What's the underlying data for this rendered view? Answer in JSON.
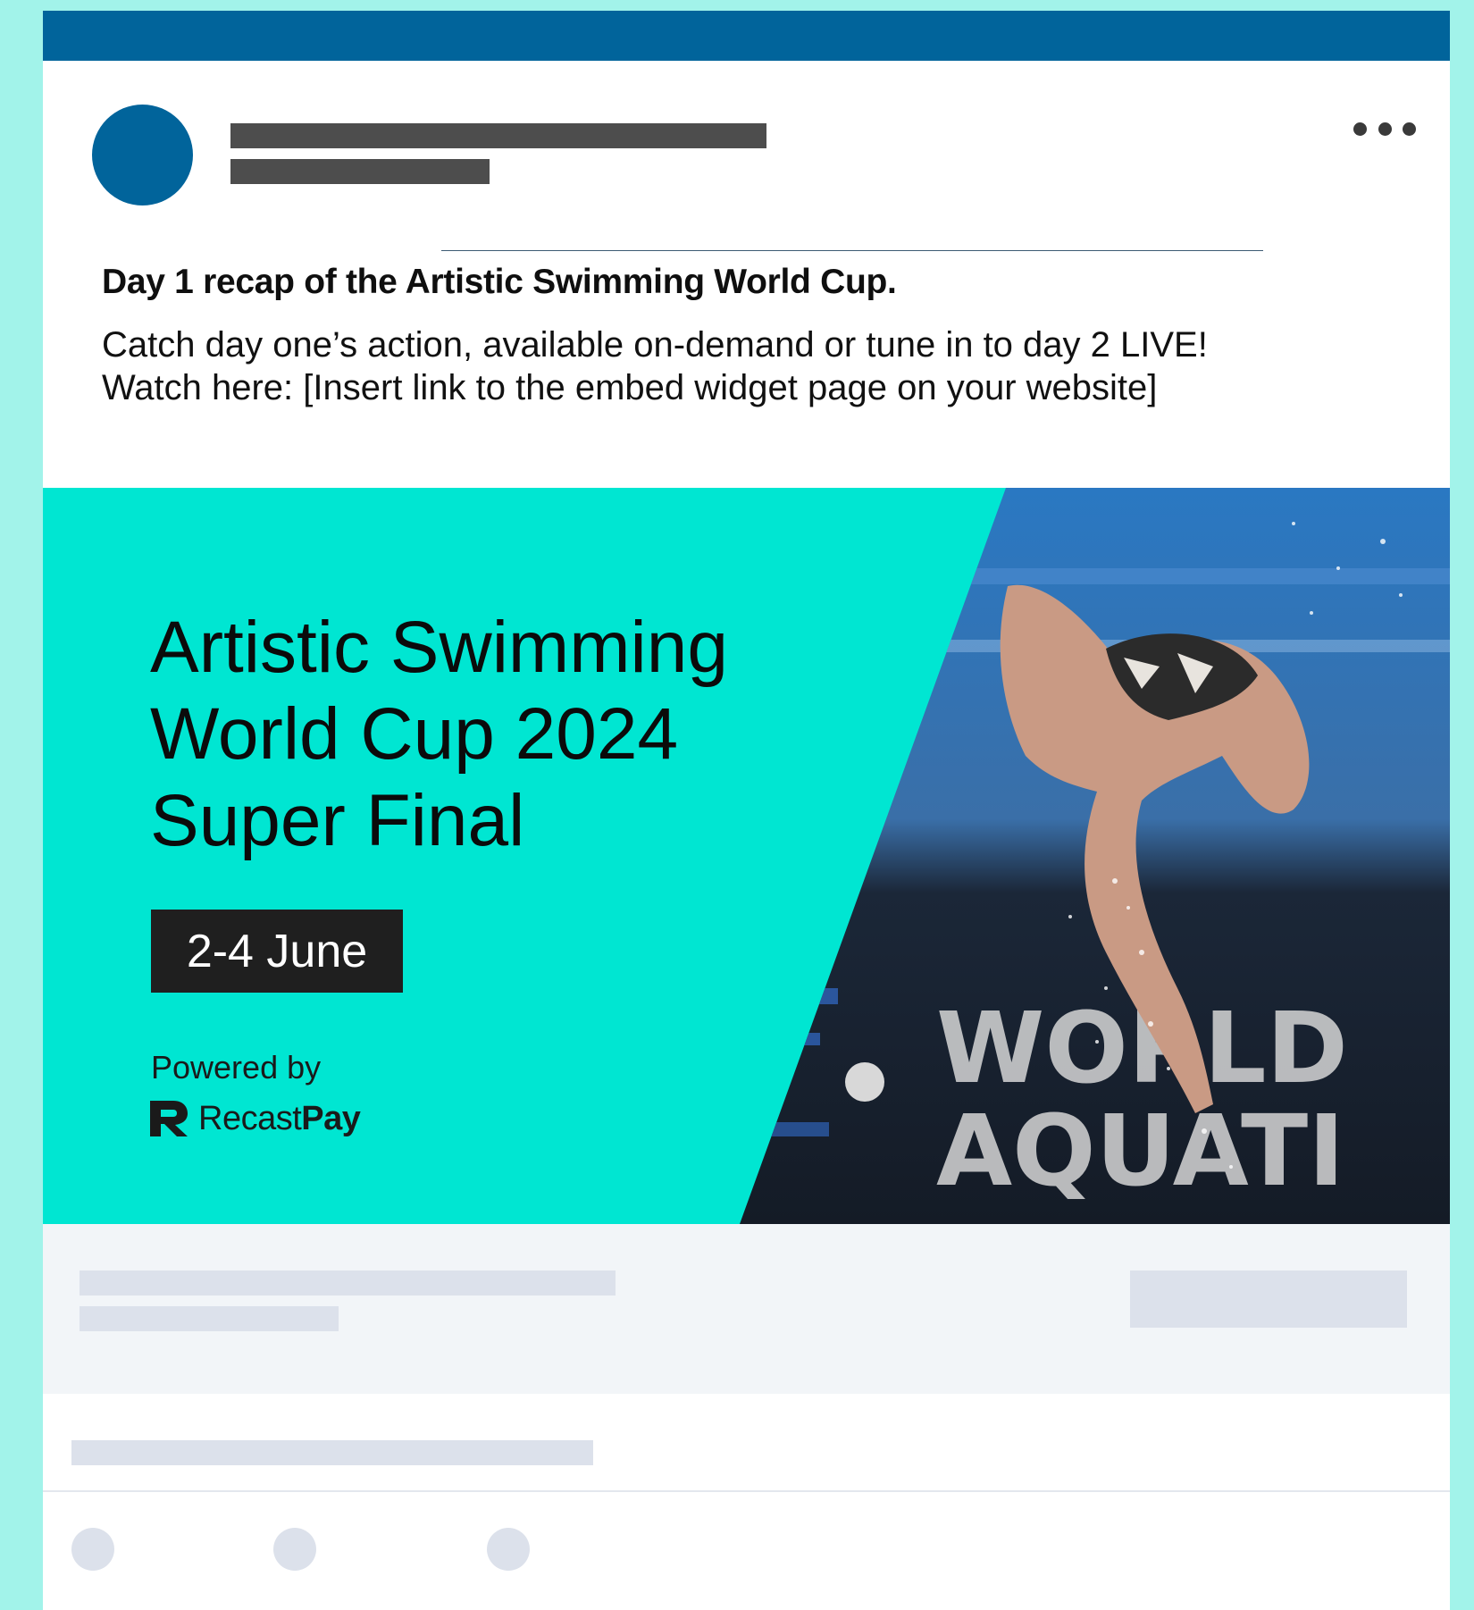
{
  "post": {
    "title": "Day 1 recap of the Artistic Swimming World Cup.",
    "body_line1": "Catch day one’s action, available on-demand or tune in to day 2 LIVE!",
    "body_line2": "Watch here: [Insert link to the embed widget page on your website]"
  },
  "banner": {
    "headline_line1": "Artistic Swimming",
    "headline_line2": "World Cup 2024",
    "headline_line3": "Super Final",
    "date": "2-4 June",
    "powered_by": "Powered by",
    "brand_regular": "Recast",
    "brand_bold": "Pay",
    "photo_text_line1": "WORLD",
    "photo_text_line2": "AQUATI"
  },
  "colors": {
    "page_background": "#a2f3ea",
    "top_bar": "#01649b",
    "avatar": "#01649b",
    "banner_accent": "#00e6d2",
    "date_badge": "#1f1f1f",
    "skeleton": "#dce1eb"
  },
  "icons": {
    "more": "more-horizontal-icon",
    "brand_logo": "recastpay-logo-icon"
  }
}
